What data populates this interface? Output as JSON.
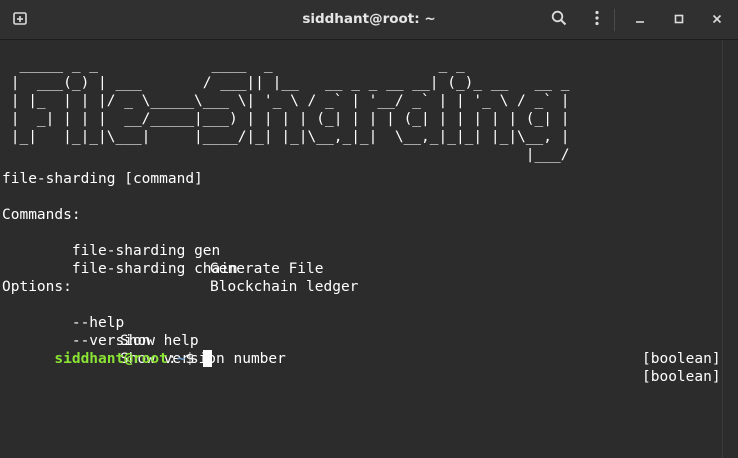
{
  "window": {
    "title": "siddhant@root: ~"
  },
  "titlebar": {
    "new_tab_icon": "new-tab-icon",
    "search_icon": "search-icon",
    "menu_icon": "kebab-menu-icon",
    "minimize_icon": "minimize-icon",
    "maximize_icon": "maximize-icon",
    "close_icon": "close-icon"
  },
  "terminal": {
    "banner": [
      "  _____ _ _             ____  _                   _ _             ",
      " |  ___(_) | ___       / ___|| |__   __ _ _ __ __| (_)_ __   __ _ ",
      " | |_  | | |/ _ \\_____\\___ \\| '_ \\ / _` | '__/ _` | | '_ \\ / _` |",
      " |  _| | | |  __/_____|___) | | | | (_| | | | (_| | | | | | (_| |",
      " |_|   |_|_|\\___|     |____/|_| |_|\\__,_|_|  \\__,_|_|_| |_|\\__, |",
      "                                                            |___/ "
    ],
    "usage": "file-sharding [command]",
    "commands_header": "Commands:",
    "commands": [
      {
        "name": "  file-sharding gen",
        "desc": "Generate File"
      },
      {
        "name": "  file-sharding chain",
        "desc": "Blockchain ledger"
      }
    ],
    "options_header": "Options:",
    "options": [
      {
        "flag": "  --help",
        "desc": "Show help",
        "type": "[boolean]"
      },
      {
        "flag": "  --version",
        "desc": "Show version number",
        "type": "[boolean]"
      }
    ],
    "prompt": {
      "user": "siddhant@root",
      "sep": ":",
      "path": "~",
      "symbol": "$ "
    }
  },
  "colors": {
    "background": "#2c2c2c",
    "titlebar": "#303030",
    "text": "#ffffff",
    "prompt_user": "#8ae234",
    "prompt_path": "#729fcf"
  }
}
